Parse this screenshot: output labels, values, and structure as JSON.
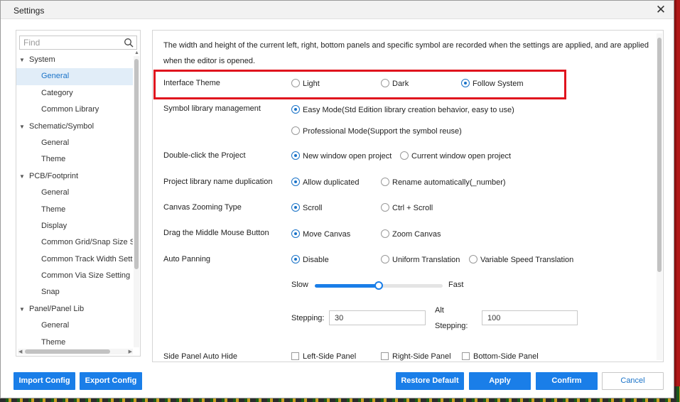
{
  "window": {
    "title": "Settings"
  },
  "sidebar": {
    "search_placeholder": "Find",
    "items": [
      {
        "label": "System",
        "type": "group"
      },
      {
        "label": "General",
        "type": "leaf",
        "selected": true
      },
      {
        "label": "Category",
        "type": "leaf"
      },
      {
        "label": "Common Library",
        "type": "leaf"
      },
      {
        "label": "Schematic/Symbol",
        "type": "group"
      },
      {
        "label": "General",
        "type": "leaf"
      },
      {
        "label": "Theme",
        "type": "leaf"
      },
      {
        "label": "PCB/Footprint",
        "type": "group"
      },
      {
        "label": "General",
        "type": "leaf"
      },
      {
        "label": "Theme",
        "type": "leaf"
      },
      {
        "label": "Display",
        "type": "leaf"
      },
      {
        "label": "Common Grid/Snap Size S",
        "type": "leaf"
      },
      {
        "label": "Common Track Width Setti",
        "type": "leaf"
      },
      {
        "label": "Common Via Size Setting",
        "type": "leaf"
      },
      {
        "label": "Snap",
        "type": "leaf"
      },
      {
        "label": "Panel/Panel Lib",
        "type": "group"
      },
      {
        "label": "General",
        "type": "leaf"
      },
      {
        "label": "Theme",
        "type": "leaf"
      }
    ]
  },
  "main": {
    "description": "The width and height of the current left, right, bottom panels and specific symbol are recorded when the settings are applied, and are applied when the editor is opened.",
    "interface_theme": {
      "label": "Interface Theme",
      "options": [
        "Light",
        "Dark",
        "Follow System"
      ],
      "selected": "Follow System"
    },
    "symbol_library": {
      "label": "Symbol library management",
      "options": [
        "Easy Mode(Std Edition library creation behavior, easy to use)",
        "Professional Mode(Support the symbol reuse)"
      ],
      "selected": "Easy Mode(Std Edition library creation behavior, easy to use)"
    },
    "double_click": {
      "label": "Double-click the Project",
      "options": [
        "New window open project",
        "Current window open project"
      ],
      "selected": "New window open project"
    },
    "name_duplication": {
      "label": "Project library name duplication",
      "options": [
        "Allow duplicated",
        "Rename automatically(_number)"
      ],
      "selected": "Allow duplicated"
    },
    "zooming": {
      "label": "Canvas Zooming Type",
      "options": [
        "Scroll",
        "Ctrl + Scroll"
      ],
      "selected": "Scroll"
    },
    "middle_mouse": {
      "label": "Drag the Middle Mouse Button",
      "options": [
        "Move Canvas",
        "Zoom Canvas"
      ],
      "selected": "Move Canvas"
    },
    "auto_panning": {
      "label": "Auto Panning",
      "options": [
        "Disable",
        "Uniform Translation",
        "Variable Speed Translation"
      ],
      "selected": "Disable",
      "slow_label": "Slow",
      "fast_label": "Fast",
      "speed_fraction": 0.5,
      "stepping_label": "Stepping:",
      "stepping_value": "30",
      "alt_label": "Alt",
      "alt_stepping_label": "Stepping:",
      "alt_stepping_value": "100"
    },
    "side_panel": {
      "label": "Side Panel Auto Hide",
      "options": [
        "Left-Side Panel",
        "Right-Side Panel",
        "Bottom-Side Panel"
      ]
    }
  },
  "footer": {
    "import_label": "Import Config",
    "export_label": "Export Config",
    "restore_label": "Restore Default",
    "apply_label": "Apply",
    "confirm_label": "Confirm",
    "cancel_label": "Cancel"
  },
  "colors": {
    "accent": "#1a7ee8",
    "highlight": "#e0141e",
    "selected_bg": "#e1edf8"
  }
}
